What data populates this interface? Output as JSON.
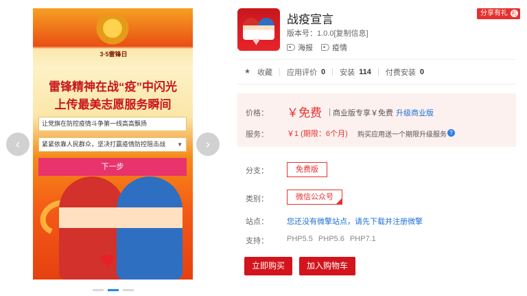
{
  "carousel": {
    "prev_arrow": "‹",
    "next_arrow": "›",
    "poster": {
      "badge_text": "3·5雷锋日",
      "headline_line1": "雷锋精神在战“疫”中闪光",
      "headline_line2": "上传最美志愿服务瞬间",
      "input1_value": "让党旗在防控疫情斗争第一线高高飘扬",
      "select_value": "紧紧依靠人民群众，坚决打赢疫情防控阻击战",
      "next_button": "下一步"
    },
    "dots": 3,
    "active_dot": 1
  },
  "app": {
    "title": "战疫宣言",
    "version_label": "版本号：",
    "version": "1.0.0",
    "copy_info": "[复制信息]",
    "tags": [
      "海报",
      "疫情"
    ],
    "share_label": "分享有礼"
  },
  "stats": {
    "favorite_label": "收藏",
    "rating_label": "应用评价",
    "rating_value": "0",
    "installs_label": "安装",
    "installs_value": "114",
    "paid_installs_label": "付费安装",
    "paid_installs_value": "0"
  },
  "pricing": {
    "price_label": "价格：",
    "price_value": "￥免费",
    "business_note": "商业版专享￥免费",
    "upgrade_link": "升级商业版",
    "service_label": "服务：",
    "service_value": "￥1 (期限：6个月)",
    "service_note": "购买应用送一个期限升级服务",
    "help_icon": "?"
  },
  "props": {
    "branch_label": "分支：",
    "branch_value": "免费版",
    "category_label": "类别：",
    "category_value": "微信公众号",
    "site_label": "站点：",
    "site_link": "您还没有微擎站点，请先下载并注册微擎",
    "support_label": "支持：",
    "support_versions": [
      "PHP5.5",
      "PHP5.6",
      "PHP7.1"
    ]
  },
  "actions": {
    "buy_now": "立即购买",
    "add_cart": "加入购物车"
  },
  "colors": {
    "accent_red": "#e5312e",
    "button_red": "#d3141c",
    "link_blue": "#1e6fd8",
    "price_bg": "#fdf1ef"
  }
}
